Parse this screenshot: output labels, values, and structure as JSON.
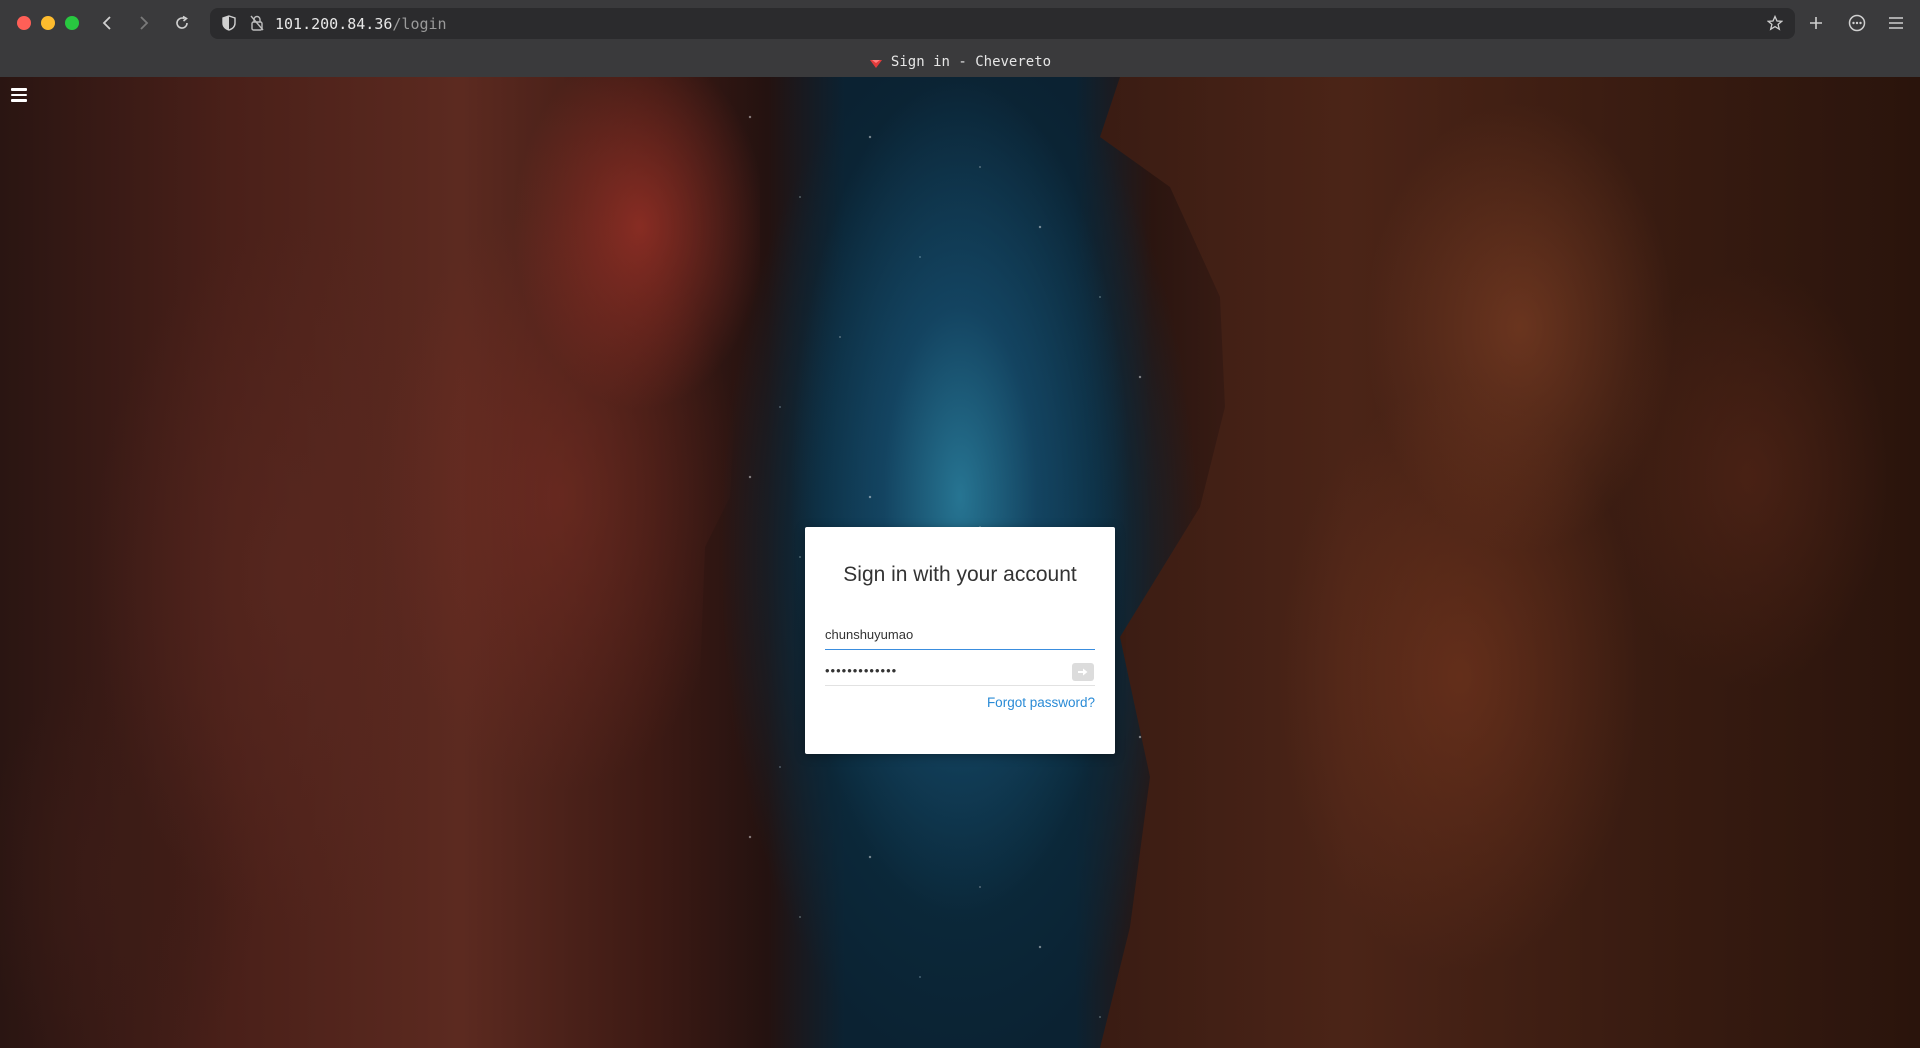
{
  "browser": {
    "url_host": "101.200.84.36",
    "url_path": "/login",
    "tab_title": "Sign in - Chevereto",
    "icons": [
      "back-icon",
      "forward-icon",
      "reload-icon",
      "shield-icon",
      "insecure-lock-icon",
      "bookmark-star-icon",
      "new-tab-plus-icon",
      "extensions-icon",
      "app-menu-icon"
    ]
  },
  "page": {
    "menu_icon": "hamburger-menu-icon"
  },
  "login": {
    "title": "Sign in with your account",
    "username_value": "chunshuyumao",
    "password_value": "•••••••••••••",
    "forgot_label": "Forgot password?",
    "submit_icon": "arrow-right-icon"
  },
  "colors": {
    "accent": "#2a8bd6",
    "card_background": "#ffffff"
  }
}
